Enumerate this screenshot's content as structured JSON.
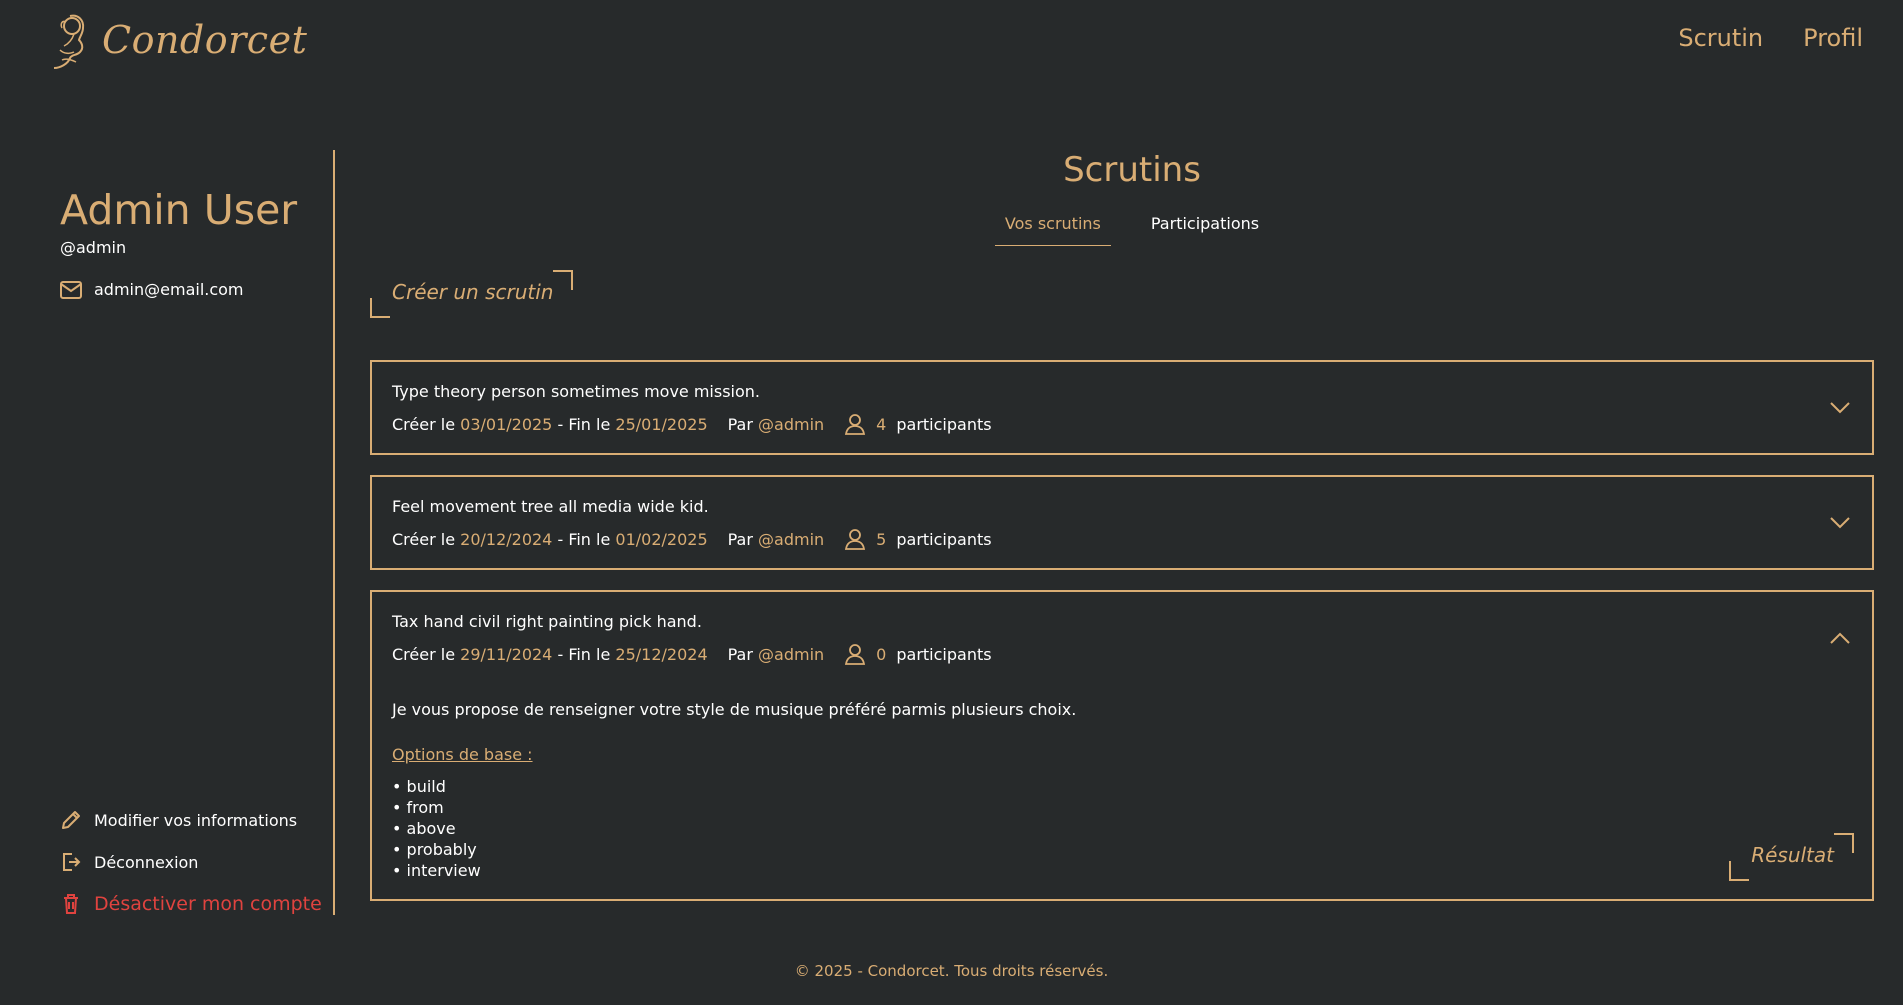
{
  "header": {
    "logo_text": "Condorcet",
    "nav": [
      {
        "label": "Scrutin"
      },
      {
        "label": "Profil"
      }
    ]
  },
  "sidebar": {
    "name": "Admin User",
    "handle": "@admin",
    "email": "admin@email.com",
    "actions": {
      "edit": "Modifier vos informations",
      "logout": "Déconnexion",
      "deactivate": "Désactiver mon compte"
    }
  },
  "main": {
    "title": "Scrutins",
    "tabs": [
      {
        "label": "Vos scrutins",
        "active": true
      },
      {
        "label": "Participations",
        "active": false
      }
    ],
    "create_label": "Créer un scrutin",
    "labels": {
      "created": "Créer le",
      "end": "- Fin le",
      "by": "Par",
      "participants": "participants"
    },
    "polls": [
      {
        "title": "Type theory person sometimes move mission.",
        "created": "03/01/2025",
        "end": "25/01/2025",
        "author": "@admin",
        "participants": "4",
        "expanded": false
      },
      {
        "title": "Feel movement tree all media wide kid.",
        "created": "20/12/2024",
        "end": "01/02/2025",
        "author": "@admin",
        "participants": "5",
        "expanded": false
      },
      {
        "title": "Tax hand civil right painting pick hand.",
        "created": "29/11/2024",
        "end": "25/12/2024",
        "author": "@admin",
        "participants": "0",
        "expanded": true,
        "description": "Je vous propose de renseigner votre style de musique préféré parmis plusieurs choix.",
        "options_title": "Options de base :",
        "options": [
          "build",
          "from",
          "above",
          "probably",
          "interview"
        ],
        "result_label": "Résultat"
      }
    ]
  },
  "footer": {
    "text": "© 2025 - Condorcet. Tous droits réservés."
  },
  "colors": {
    "background": "#272a2b",
    "accent": "#d9ad74",
    "danger": "#e0433f",
    "text": "#ffffff"
  }
}
